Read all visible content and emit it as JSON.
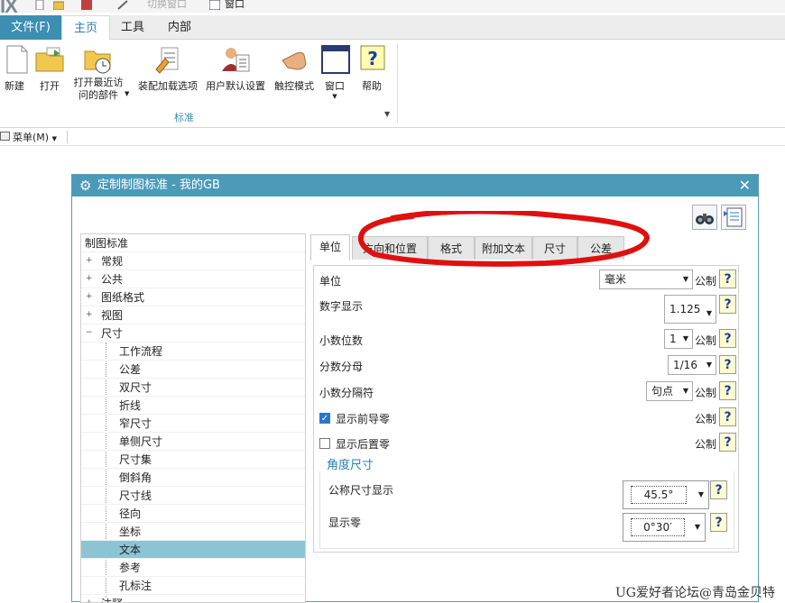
{
  "app": {
    "logo": "IX",
    "quick_access_partial_label": "切换窗口",
    "quick_window_label": "窗口"
  },
  "ribbon_tabs": {
    "file": "文件(F)",
    "home": "主页",
    "tools": "工具",
    "internal": "内部"
  },
  "ribbon": {
    "buttons": [
      {
        "label": "新建",
        "icon": "new-file-icon"
      },
      {
        "label": "打开",
        "icon": "open-folder-icon"
      },
      {
        "label": "打开最近访问的部件",
        "icon": "recent-folder-icon"
      },
      {
        "label": "装配加载选项",
        "icon": "assembly-load-icon"
      },
      {
        "label": "用户默认设置",
        "icon": "user-defaults-icon"
      },
      {
        "label": "触控模式",
        "icon": "touch-mode-icon"
      },
      {
        "label": "窗口",
        "icon": "window-icon"
      },
      {
        "label": "帮助",
        "icon": "help-icon"
      }
    ],
    "group_label": "标准"
  },
  "menubar": {
    "menu_label": "菜单(M)"
  },
  "dialog": {
    "title": "定制制图标准 - 我的GB",
    "tree": {
      "root": "制图标准",
      "nodes": [
        "常规",
        "公共",
        "图纸格式",
        "视图",
        "尺寸"
      ],
      "children": [
        "工作流程",
        "公差",
        "双尺寸",
        "折线",
        "窄尺寸",
        "单侧尺寸",
        "尺寸集",
        "倒斜角",
        "尺寸线",
        "径向",
        "坐标",
        "文本",
        "参考",
        "孔标注"
      ],
      "selected": "文本",
      "partial_next": "注释"
    },
    "tabs": [
      "单位",
      "方向和位置",
      "格式",
      "附加文本",
      "尺寸",
      "公差"
    ],
    "active_tab": "单位",
    "units": {
      "unit_label": "单位",
      "unit_value": "毫米",
      "metric": "公制",
      "decimal_display_label": "数字显示",
      "decimal_display_value": "1.125",
      "decimal_places_label": "小数位数",
      "decimal_places_value": "1",
      "fraction_denominator_label": "分数分母",
      "fraction_denominator_value": "1/16",
      "decimal_separator_label": "小数分隔符",
      "decimal_separator_value": "句点",
      "show_leading_zeros_label": "显示前导零",
      "show_leading_zeros": true,
      "show_trailing_zeros_label": "显示后置零",
      "show_trailing_zeros": false,
      "angle_section_label": "角度尺寸",
      "nominal_angle_label": "公称尺寸显示",
      "nominal_angle_value": "45.5°",
      "show_zero_label": "显示零",
      "show_zero_value": "0°30′"
    }
  },
  "watermark": "UG爱好者论坛@青岛金贝特",
  "colors": {
    "accent": "#4a9ab8",
    "selection": "#8dc4d4",
    "annotation": "#e01010"
  }
}
